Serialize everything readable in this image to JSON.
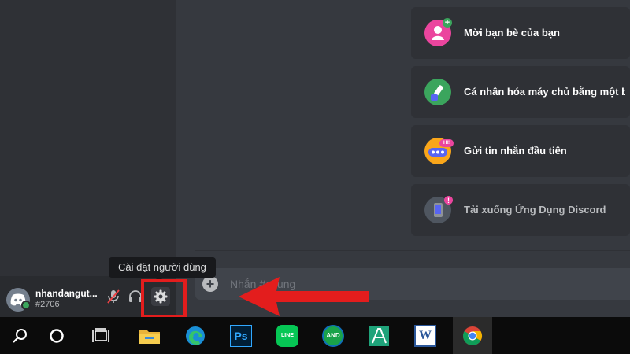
{
  "user": {
    "name": "nhandangut...",
    "discriminator": "#2706",
    "status_color": "#3ba55d"
  },
  "tooltip": {
    "text": "Cài đặt người dùng"
  },
  "composer": {
    "placeholder": "Nhắn #chung"
  },
  "cards": [
    {
      "label": "Mời bạn bè của bạn",
      "icon": "invite-friends-icon",
      "color": "#eb459e"
    },
    {
      "label": "Cá nhân hóa máy chủ bằng một biểu tượng",
      "icon": "customize-server-icon",
      "color": "#3ba55d"
    },
    {
      "label": "Gửi tin nhắn đầu tiên",
      "icon": "first-message-icon",
      "color": "#faa61a"
    },
    {
      "label": "Tải xuống Ứng Dụng Discord",
      "icon": "download-app-icon",
      "color": "#4f5660"
    }
  ],
  "badges": {
    "hi": "HI!",
    "exclamation": "!"
  },
  "annotation": {
    "color": "#e31d1d"
  },
  "taskbar": {
    "apps": [
      {
        "name": "search-icon"
      },
      {
        "name": "cortana-icon"
      },
      {
        "name": "task-view-icon"
      },
      {
        "name": "file-explorer-icon"
      },
      {
        "name": "edge-icon"
      },
      {
        "name": "photoshop-icon",
        "text": "Ps"
      },
      {
        "name": "line-icon",
        "text": "LINE"
      },
      {
        "name": "and-icon",
        "text": "AND"
      },
      {
        "name": "mathtype-icon"
      },
      {
        "name": "word-icon",
        "text": "W"
      },
      {
        "name": "chrome-icon"
      }
    ]
  }
}
